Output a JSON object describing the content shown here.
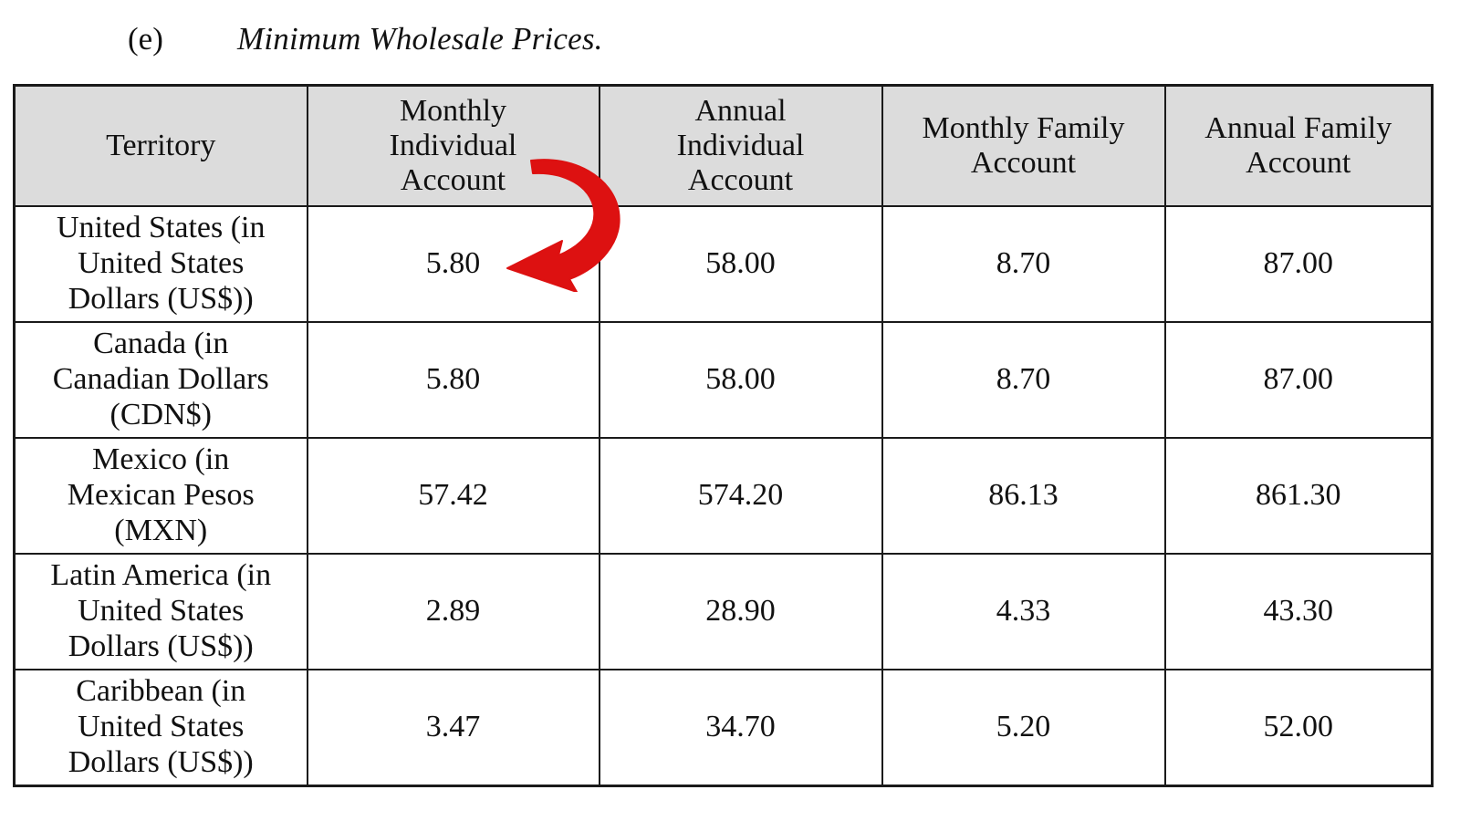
{
  "heading": {
    "marker": "(e)",
    "title": "Minimum Wholesale Prices."
  },
  "table": {
    "columns": [
      {
        "id": "territory",
        "label": "Territory",
        "lines": [
          "Territory"
        ]
      },
      {
        "id": "monthly_individual",
        "label": "Monthly Individual Account",
        "lines": [
          "Monthly",
          "Individual",
          "Account"
        ]
      },
      {
        "id": "annual_individual",
        "label": "Annual Individual Account",
        "lines": [
          "Annual",
          "Individual",
          "Account"
        ]
      },
      {
        "id": "monthly_family",
        "label": "Monthly Family Account",
        "lines": [
          "Monthly Family",
          "Account"
        ]
      },
      {
        "id": "annual_family",
        "label": "Annual Family Account",
        "lines": [
          "Annual Family",
          "Account"
        ]
      }
    ],
    "rows": [
      {
        "territory": "United States (in United States Dollars (US$))",
        "territory_lines": [
          "United States (in",
          "United States",
          "Dollars (US$))"
        ],
        "monthly_individual": "5.80",
        "annual_individual": "58.00",
        "monthly_family": "8.70",
        "annual_family": "87.00"
      },
      {
        "territory": "Canada (in Canadian Dollars (CDN$)",
        "territory_lines": [
          "Canada (in",
          "Canadian Dollars",
          "(CDN$)"
        ],
        "monthly_individual": "5.80",
        "annual_individual": "58.00",
        "monthly_family": "8.70",
        "annual_family": "87.00"
      },
      {
        "territory": "Mexico (in Mexican Pesos (MXN)",
        "territory_lines": [
          "Mexico (in",
          "Mexican Pesos",
          "(MXN)"
        ],
        "monthly_individual": "57.42",
        "annual_individual": "574.20",
        "monthly_family": "86.13",
        "annual_family": "861.30"
      },
      {
        "territory": "Latin America (in United States Dollars (US$))",
        "territory_lines": [
          "Latin America (in",
          "United States",
          "Dollars (US$))"
        ],
        "monthly_individual": "2.89",
        "annual_individual": "28.90",
        "monthly_family": "4.33",
        "annual_family": "43.30"
      },
      {
        "territory": "Caribbean (in United States Dollars (US$))",
        "territory_lines": [
          "Caribbean (in",
          "United States",
          "Dollars (US$))"
        ],
        "monthly_individual": "3.47",
        "annual_individual": "34.70",
        "monthly_family": "5.20",
        "annual_family": "52.00"
      }
    ]
  },
  "annotation": {
    "type": "curved-arrow",
    "color": "#DD1111",
    "points_to": "5.80",
    "target_cell": "United States / Monthly Individual Account"
  },
  "colors": {
    "header_fill": "#dcdcdc",
    "border": "#1a1a1a",
    "text": "#111111",
    "annotation_red": "#DD1111",
    "page_background": "#ffffff"
  }
}
